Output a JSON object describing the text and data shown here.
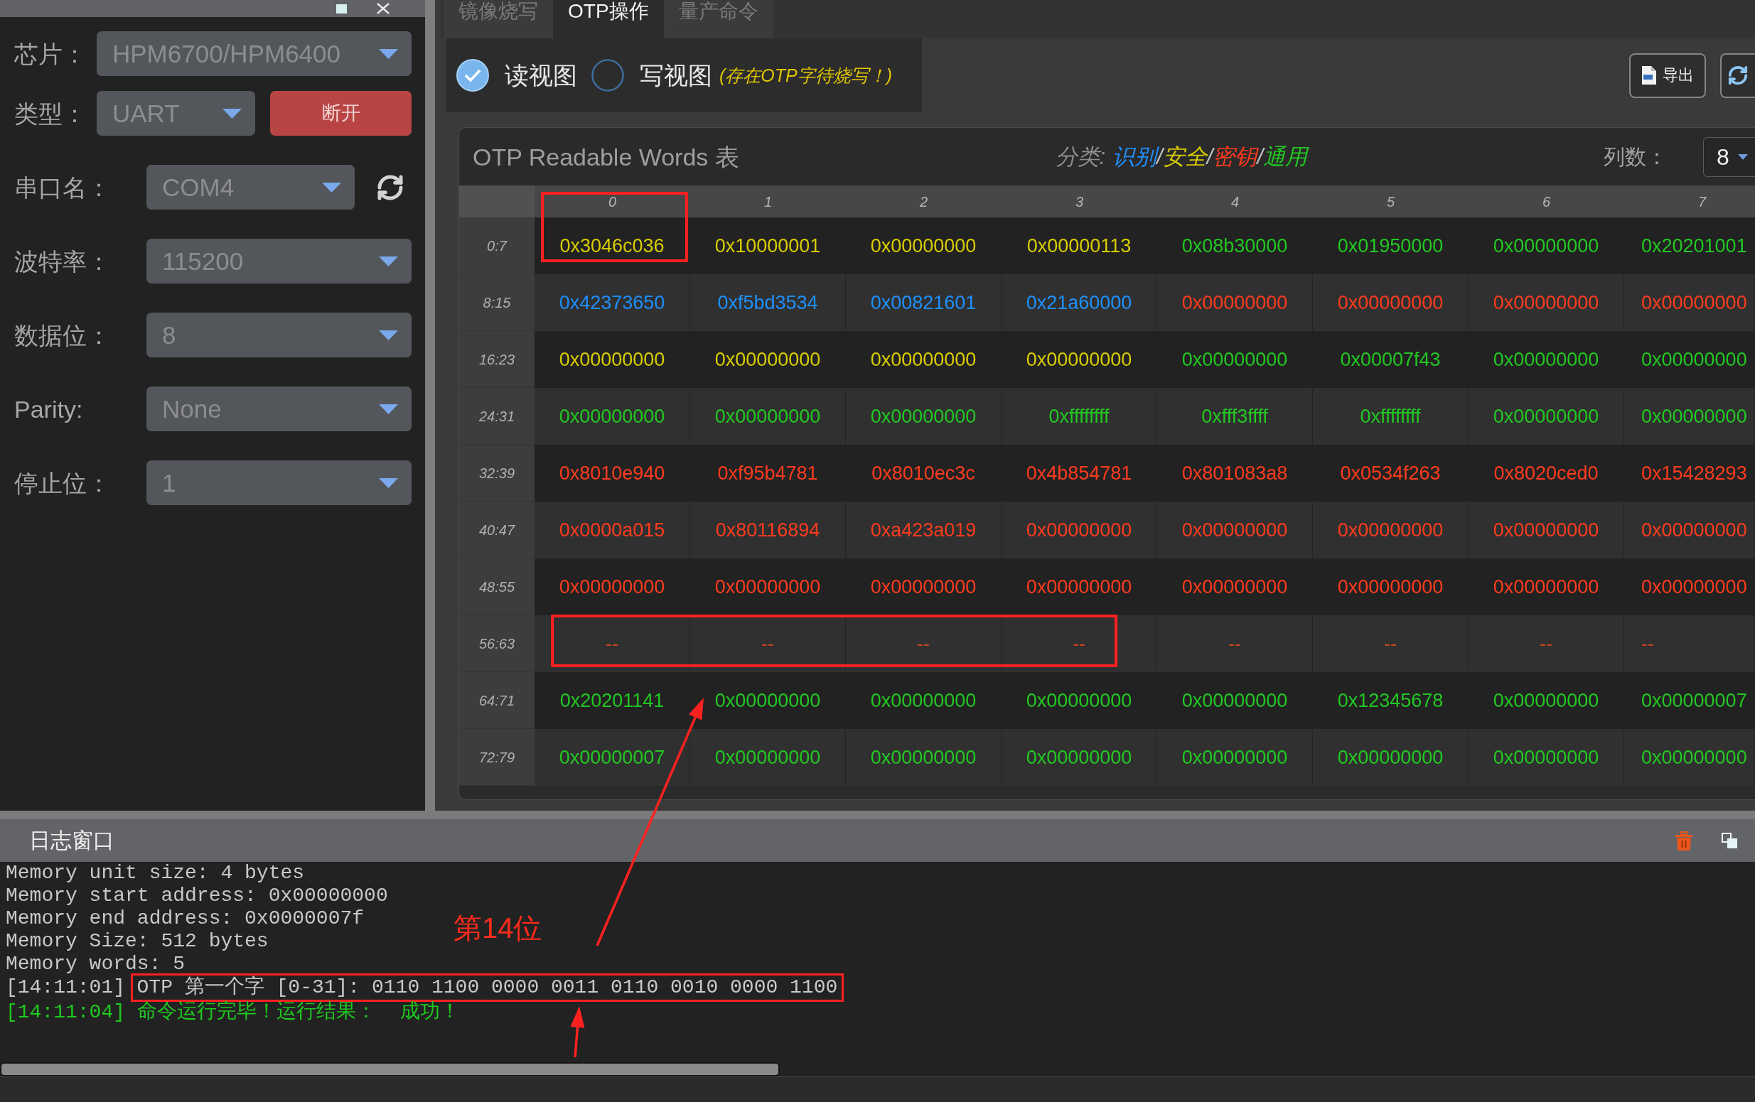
{
  "device_panel": {
    "chip": {
      "label": "芯片：",
      "value": "HPM6700/HPM6400",
      "disabled": true
    },
    "link": {
      "label": "类型：",
      "value": "UART",
      "disabled": true,
      "button": "断开"
    },
    "port_settings": [
      {
        "kind": "refreshable",
        "label": "串口名：",
        "value": "COM4",
        "disabled": true
      },
      {
        "kind": "plain",
        "label": "波特率：",
        "value": "115200",
        "disabled": true
      },
      {
        "kind": "plain",
        "label": "数据位：",
        "value": "8",
        "disabled": true
      },
      {
        "kind": "plain",
        "label": "Parity:",
        "value": "None",
        "disabled": true
      },
      {
        "kind": "plain",
        "label": "停止位：",
        "value": "1",
        "disabled": true
      }
    ]
  },
  "tabs": [
    {
      "label": "镜像烧写",
      "selected": false
    },
    {
      "label": "OTP操作",
      "selected": true
    },
    {
      "label": "量产命令",
      "selected": false
    }
  ],
  "toolbar": {
    "view_modes": [
      {
        "label": "读视图",
        "selected": true
      },
      {
        "label": "写视图",
        "selected": false
      }
    ],
    "notice": "(存在OTP字待烧写！)",
    "buttons": [
      {
        "kind": "export",
        "label": "导出"
      },
      {
        "kind": "refresh"
      }
    ]
  },
  "otp_table": {
    "title": "OTP Readable Words 表",
    "legend": [
      {
        "kind": "caption",
        "label": "分类:"
      },
      {
        "kind": "category",
        "label": "识别",
        "color": "#1e90ff"
      },
      {
        "kind": "separator",
        "label": "/"
      },
      {
        "kind": "category",
        "label": "安全",
        "color": "#d8cc00"
      },
      {
        "kind": "separator",
        "label": "/"
      },
      {
        "kind": "category",
        "label": "密钥",
        "color": "#ff3b1e"
      },
      {
        "kind": "separator",
        "label": "/"
      },
      {
        "kind": "category",
        "label": "通用",
        "color": "#22c822"
      }
    ],
    "columns_label": "列数：",
    "columns_value": "8",
    "columns": [
      "0",
      "1",
      "2",
      "3",
      "4",
      "5",
      "6",
      "7"
    ],
    "rows": [
      {
        "label": "0:7",
        "cells": [
          {
            "text": "0x3046c036",
            "color": "#d8cc00"
          },
          {
            "text": "0x10000001",
            "color": "#d8cc00"
          },
          {
            "text": "0x00000000",
            "color": "#d8cc00"
          },
          {
            "text": "0x00000113",
            "color": "#d8cc00"
          },
          {
            "text": "0x08b30000",
            "color": "#22c822"
          },
          {
            "text": "0x01950000",
            "color": "#22c822"
          },
          {
            "text": "0x00000000",
            "color": "#22c822"
          },
          {
            "text": "0x20201001",
            "color": "#22c822"
          }
        ]
      },
      {
        "label": "8:15",
        "cells": [
          {
            "text": "0x42373650",
            "color": "#1e90ff"
          },
          {
            "text": "0xf5bd3534",
            "color": "#1e90ff"
          },
          {
            "text": "0x00821601",
            "color": "#1e90ff"
          },
          {
            "text": "0x21a60000",
            "color": "#1e90ff"
          },
          {
            "text": "0x00000000",
            "color": "#ff3b1e"
          },
          {
            "text": "0x00000000",
            "color": "#ff3b1e"
          },
          {
            "text": "0x00000000",
            "color": "#ff3b1e"
          },
          {
            "text": "0x00000000",
            "color": "#ff3b1e"
          }
        ]
      },
      {
        "label": "16:23",
        "cells": [
          {
            "text": "0x00000000",
            "color": "#d8cc00"
          },
          {
            "text": "0x00000000",
            "color": "#d8cc00"
          },
          {
            "text": "0x00000000",
            "color": "#d8cc00"
          },
          {
            "text": "0x00000000",
            "color": "#d8cc00"
          },
          {
            "text": "0x00000000",
            "color": "#22c822"
          },
          {
            "text": "0x00007f43",
            "color": "#22c822"
          },
          {
            "text": "0x00000000",
            "color": "#22c822"
          },
          {
            "text": "0x00000000",
            "color": "#22c822"
          }
        ]
      },
      {
        "label": "24:31",
        "cells": [
          {
            "text": "0x00000000",
            "color": "#22c822"
          },
          {
            "text": "0x00000000",
            "color": "#22c822"
          },
          {
            "text": "0x00000000",
            "color": "#22c822"
          },
          {
            "text": "0xffffffff",
            "color": "#22c822"
          },
          {
            "text": "0xfff3ffff",
            "color": "#22c822"
          },
          {
            "text": "0xffffffff",
            "color": "#22c822"
          },
          {
            "text": "0x00000000",
            "color": "#22c822"
          },
          {
            "text": "0x00000000",
            "color": "#22c822"
          }
        ]
      },
      {
        "label": "32:39",
        "cells": [
          {
            "text": "0x8010e940",
            "color": "#ff3b1e"
          },
          {
            "text": "0xf95b4781",
            "color": "#ff3b1e"
          },
          {
            "text": "0x8010ec3c",
            "color": "#ff3b1e"
          },
          {
            "text": "0x4b854781",
            "color": "#ff3b1e"
          },
          {
            "text": "0x801083a8",
            "color": "#ff3b1e"
          },
          {
            "text": "0x0534f263",
            "color": "#ff3b1e"
          },
          {
            "text": "0x8020ced0",
            "color": "#ff3b1e"
          },
          {
            "text": "0x15428293",
            "color": "#ff3b1e"
          }
        ]
      },
      {
        "label": "40:47",
        "cells": [
          {
            "text": "0x0000a015",
            "color": "#ff3b1e"
          },
          {
            "text": "0x80116894",
            "color": "#ff3b1e"
          },
          {
            "text": "0xa423a019",
            "color": "#ff3b1e"
          },
          {
            "text": "0x00000000",
            "color": "#ff3b1e"
          },
          {
            "text": "0x00000000",
            "color": "#ff3b1e"
          },
          {
            "text": "0x00000000",
            "color": "#ff3b1e"
          },
          {
            "text": "0x00000000",
            "color": "#ff3b1e"
          },
          {
            "text": "0x00000000",
            "color": "#ff3b1e"
          }
        ]
      },
      {
        "label": "48:55",
        "cells": [
          {
            "text": "0x00000000",
            "color": "#ff3b1e"
          },
          {
            "text": "0x00000000",
            "color": "#ff3b1e"
          },
          {
            "text": "0x00000000",
            "color": "#ff3b1e"
          },
          {
            "text": "0x00000000",
            "color": "#ff3b1e"
          },
          {
            "text": "0x00000000",
            "color": "#ff3b1e"
          },
          {
            "text": "0x00000000",
            "color": "#ff3b1e"
          },
          {
            "text": "0x00000000",
            "color": "#ff3b1e"
          },
          {
            "text": "0x00000000",
            "color": "#ff3b1e"
          }
        ]
      },
      {
        "label": "56:63",
        "cells": [
          {
            "text": "--",
            "color": "#c4461f"
          },
          {
            "text": "--",
            "color": "#c4461f"
          },
          {
            "text": "--",
            "color": "#c4461f"
          },
          {
            "text": "--",
            "color": "#c4461f"
          },
          {
            "text": "--",
            "color": "#c4461f"
          },
          {
            "text": "--",
            "color": "#c4461f"
          },
          {
            "text": "--",
            "color": "#c4461f"
          },
          {
            "text": "--",
            "color": "#c4461f"
          }
        ]
      },
      {
        "label": "64:71",
        "cells": [
          {
            "text": "0x20201141",
            "color": "#22c822"
          },
          {
            "text": "0x00000000",
            "color": "#22c822"
          },
          {
            "text": "0x00000000",
            "color": "#22c822"
          },
          {
            "text": "0x00000000",
            "color": "#22c822"
          },
          {
            "text": "0x00000000",
            "color": "#22c822"
          },
          {
            "text": "0x12345678",
            "color": "#22c822"
          },
          {
            "text": "0x00000000",
            "color": "#22c822"
          },
          {
            "text": "0x00000007",
            "color": "#22c822"
          }
        ]
      },
      {
        "label": "72:79",
        "cells": [
          {
            "text": "0x00000007",
            "color": "#22c822"
          },
          {
            "text": "0x00000000",
            "color": "#22c822"
          },
          {
            "text": "0x00000000",
            "color": "#22c822"
          },
          {
            "text": "0x00000000",
            "color": "#22c822"
          },
          {
            "text": "0x00000000",
            "color": "#22c822"
          },
          {
            "text": "0x00000000",
            "color": "#22c822"
          },
          {
            "text": "0x00000000",
            "color": "#22c822"
          },
          {
            "text": "0x00000000",
            "color": "#22c822"
          }
        ]
      }
    ]
  },
  "annotation": {
    "label": "第14位"
  },
  "log": {
    "title": "日志窗口",
    "lines": [
      {
        "kind": "info",
        "text": "Memory unit size: 4 bytes",
        "highlighted": false
      },
      {
        "kind": "info",
        "text": "Memory start address: 0x00000000",
        "highlighted": false
      },
      {
        "kind": "info",
        "text": "Memory end address: 0x0000007f",
        "highlighted": false
      },
      {
        "kind": "info",
        "text": "Memory Size: 512 bytes",
        "highlighted": false
      },
      {
        "kind": "info",
        "text": "Memory words: 5",
        "highlighted": false
      },
      {
        "kind": "info",
        "time": "[14:11:01]",
        "text": "OTP 第一个字 [0-31]: 0110 1100 0000 0011 0110 0010 0000 1100",
        "highlighted": true
      },
      {
        "kind": "success",
        "time": "[14:11:04]",
        "text": "命令运行完毕！运行结果：  成功！",
        "highlighted": false
      }
    ]
  }
}
